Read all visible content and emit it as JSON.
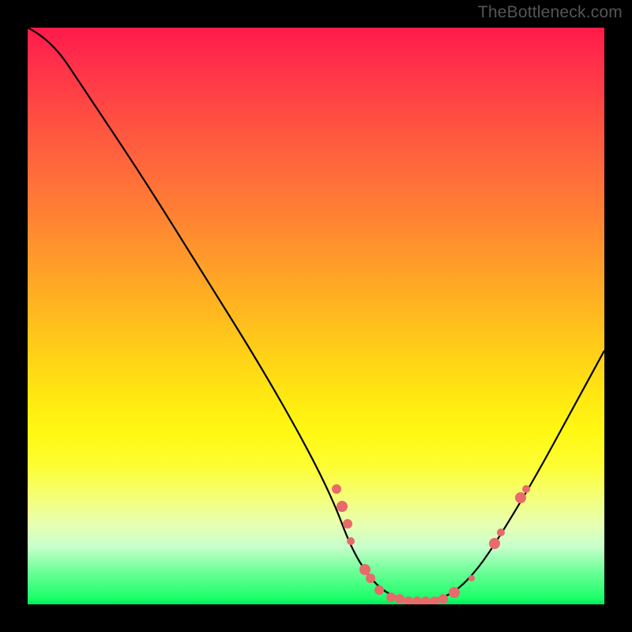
{
  "attribution": "TheBottleneck.com",
  "chart_data": {
    "type": "line",
    "title": "",
    "xlabel": "",
    "ylabel": "",
    "xlim": [
      0,
      100
    ],
    "ylim": [
      0,
      100
    ],
    "curve": [
      {
        "x": 0,
        "y": 100
      },
      {
        "x": 4,
        "y": 98
      },
      {
        "x": 10,
        "y": 89
      },
      {
        "x": 20,
        "y": 74
      },
      {
        "x": 30,
        "y": 58
      },
      {
        "x": 40,
        "y": 42
      },
      {
        "x": 48,
        "y": 28
      },
      {
        "x": 53,
        "y": 18
      },
      {
        "x": 56,
        "y": 10
      },
      {
        "x": 59,
        "y": 5
      },
      {
        "x": 62,
        "y": 2
      },
      {
        "x": 66,
        "y": 0.5
      },
      {
        "x": 70,
        "y": 0.5
      },
      {
        "x": 74,
        "y": 2
      },
      {
        "x": 78,
        "y": 6
      },
      {
        "x": 82,
        "y": 12
      },
      {
        "x": 88,
        "y": 22
      },
      {
        "x": 94,
        "y": 33
      },
      {
        "x": 100,
        "y": 44
      }
    ],
    "dots": [
      {
        "x": 53.5,
        "y": 20,
        "r": 6
      },
      {
        "x": 54.5,
        "y": 17,
        "r": 7
      },
      {
        "x": 55.5,
        "y": 14,
        "r": 6
      },
      {
        "x": 56.0,
        "y": 11,
        "r": 5
      },
      {
        "x": 58.5,
        "y": 6,
        "r": 7
      },
      {
        "x": 59.5,
        "y": 4.5,
        "r": 6
      },
      {
        "x": 61.0,
        "y": 2.5,
        "r": 6
      },
      {
        "x": 63.0,
        "y": 1.3,
        "r": 6
      },
      {
        "x": 64.5,
        "y": 0.9,
        "r": 6
      },
      {
        "x": 66.0,
        "y": 0.6,
        "r": 6
      },
      {
        "x": 67.5,
        "y": 0.5,
        "r": 6
      },
      {
        "x": 69.0,
        "y": 0.5,
        "r": 6
      },
      {
        "x": 70.5,
        "y": 0.6,
        "r": 6
      },
      {
        "x": 72.0,
        "y": 0.9,
        "r": 6
      },
      {
        "x": 74.0,
        "y": 2.0,
        "r": 7
      },
      {
        "x": 77.0,
        "y": 4.5,
        "r": 4
      },
      {
        "x": 81.0,
        "y": 10.5,
        "r": 7
      },
      {
        "x": 82.0,
        "y": 12.5,
        "r": 5
      },
      {
        "x": 85.5,
        "y": 18.5,
        "r": 7
      },
      {
        "x": 86.5,
        "y": 20.0,
        "r": 5
      }
    ]
  }
}
